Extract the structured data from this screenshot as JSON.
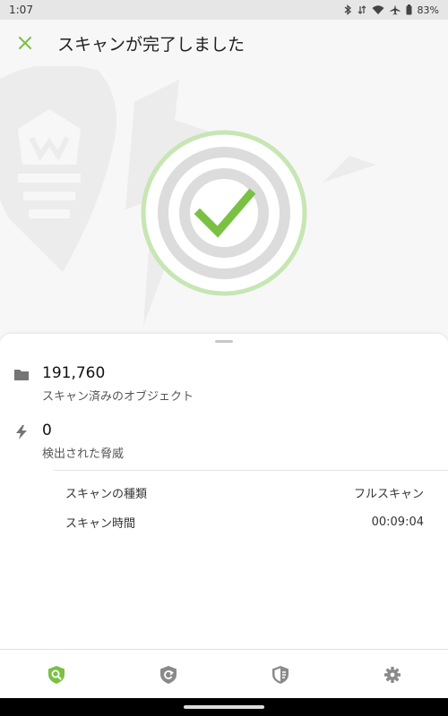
{
  "status_bar": {
    "time": "1:07",
    "battery": "83%",
    "icons": [
      "bluetooth-icon",
      "data-saver-icon",
      "wifi-icon",
      "airplane-icon",
      "battery-icon"
    ]
  },
  "app_bar": {
    "close_icon": "close-icon",
    "title": "スキャンが完了しました"
  },
  "colors": {
    "accent": "#7ac143",
    "ring_light": "#c6e6b4",
    "grey_ring": "#dcdcdc"
  },
  "results": {
    "objects": {
      "value": "191,760",
      "label": "スキャン済みのオブジェクト",
      "icon": "folder-icon"
    },
    "threats": {
      "value": "0",
      "label": "検出された脅威",
      "icon": "lightning-icon"
    }
  },
  "details": [
    {
      "key": "スキャンの種類",
      "value": "フルスキャン"
    },
    {
      "key": "スキャン時間",
      "value": "00:09:04"
    }
  ],
  "bottom_nav": [
    {
      "icon": "scanner-icon",
      "active": true
    },
    {
      "icon": "update-icon",
      "active": false
    },
    {
      "icon": "security-shield-icon",
      "active": false
    },
    {
      "icon": "settings-gear-icon",
      "active": false
    }
  ]
}
